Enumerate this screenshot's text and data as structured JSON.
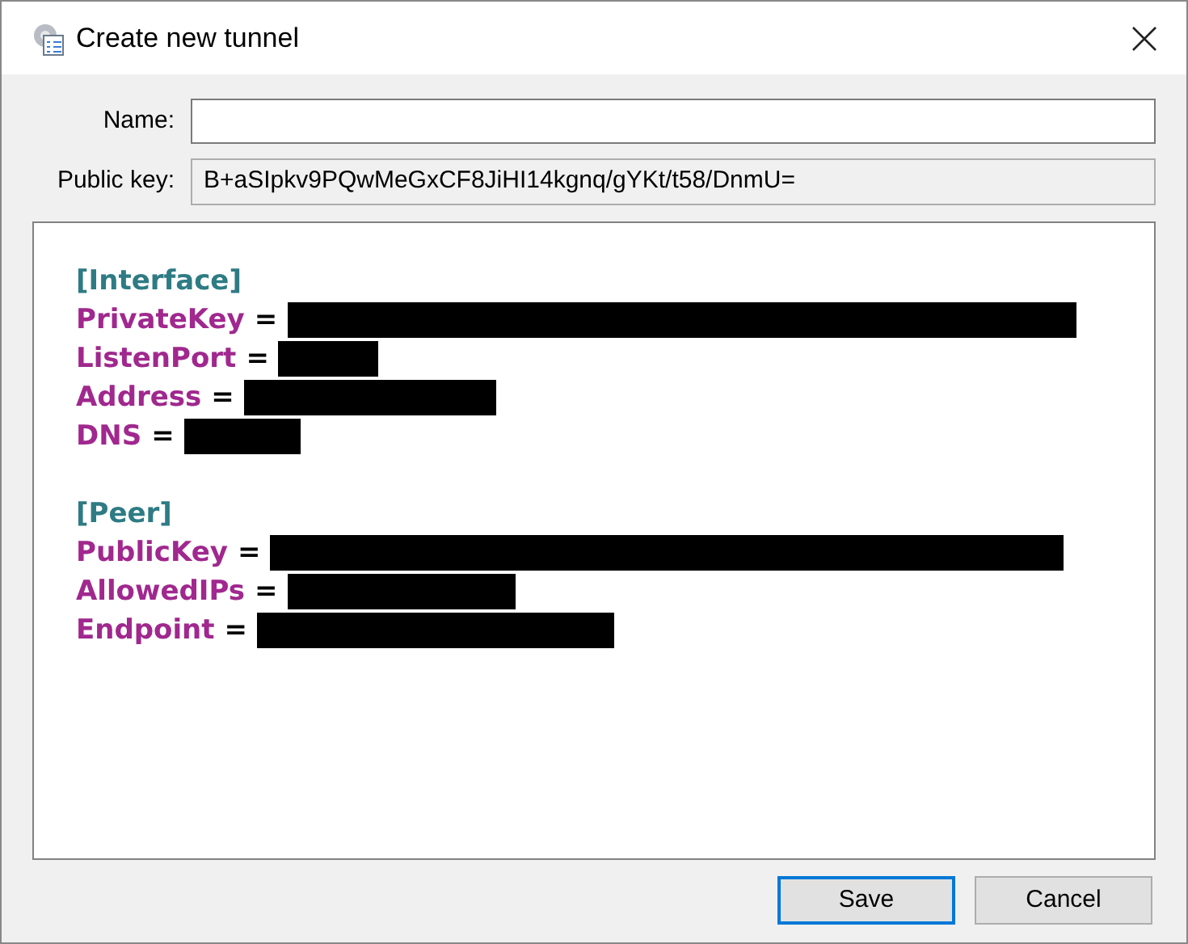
{
  "window": {
    "title": "Create new tunnel"
  },
  "name_field": {
    "label": "Name:"
  },
  "public_key_field": {
    "label": "Public key:",
    "value": "B+aSIpkv9PQwMeGxCF8JiHI14kgnq/gYKt/t58/DnmU="
  },
  "editor": {
    "lines": [
      {
        "kind": "section",
        "text": "[Interface]"
      },
      {
        "kind": "key",
        "key": "PrivateKey",
        "operator": "=",
        "redacted": true
      },
      {
        "kind": "key",
        "key": "ListenPort",
        "operator": "=",
        "redacted": true
      },
      {
        "kind": "key",
        "key": "Address",
        "operator": "=",
        "redacted": true
      },
      {
        "kind": "key",
        "key": "DNS",
        "operator": "=",
        "redacted": true
      },
      {
        "kind": "blank"
      },
      {
        "kind": "section",
        "text": "[Peer]"
      },
      {
        "kind": "key",
        "key": "PublicKey",
        "operator": "=",
        "redacted": true
      },
      {
        "kind": "key",
        "key": "AllowedIPs",
        "operator": "=",
        "redacted": true
      },
      {
        "kind": "key",
        "key": "Endpoint",
        "operator": "=",
        "redacted": true
      }
    ]
  },
  "buttons": [
    {
      "label": "Save",
      "default": true
    },
    {
      "label": "Cancel",
      "default": false
    }
  ]
}
